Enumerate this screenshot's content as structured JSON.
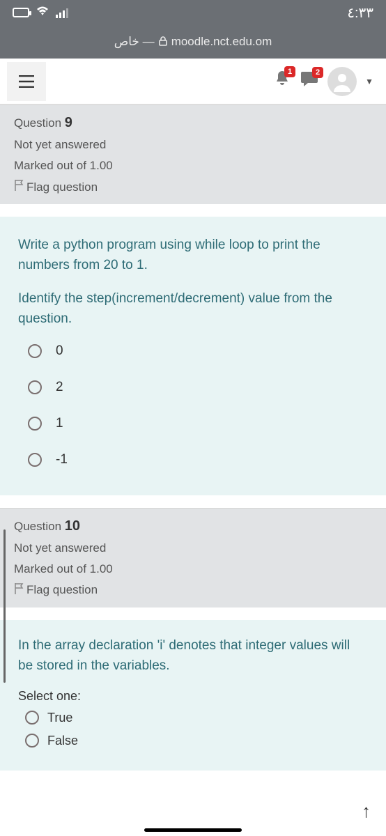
{
  "status": {
    "time": "٤:٣٣"
  },
  "browser": {
    "secure_label": "خاص —",
    "url": "moodle.nct.edu.om"
  },
  "header": {
    "notif_count": "1",
    "msg_count": "2"
  },
  "question9": {
    "label_prefix": "Question",
    "number": "9",
    "status": "Not yet answered",
    "marks": "Marked out of 1.00",
    "flag": "Flag question",
    "text1": "Write a python program using while loop to print the numbers from 20 to 1.",
    "text2": "Identify the step(increment/decrement) value from the question.",
    "options": [
      "0",
      "2",
      "1",
      "-1"
    ]
  },
  "question10": {
    "label_prefix": "Question",
    "number": "10",
    "status": "Not yet answered",
    "marks": "Marked out of 1.00",
    "flag": "Flag question",
    "text": "In the array declaration 'i' denotes that integer values will be stored in the variables.",
    "select_one": "Select one:",
    "options": [
      "True",
      "False"
    ]
  }
}
